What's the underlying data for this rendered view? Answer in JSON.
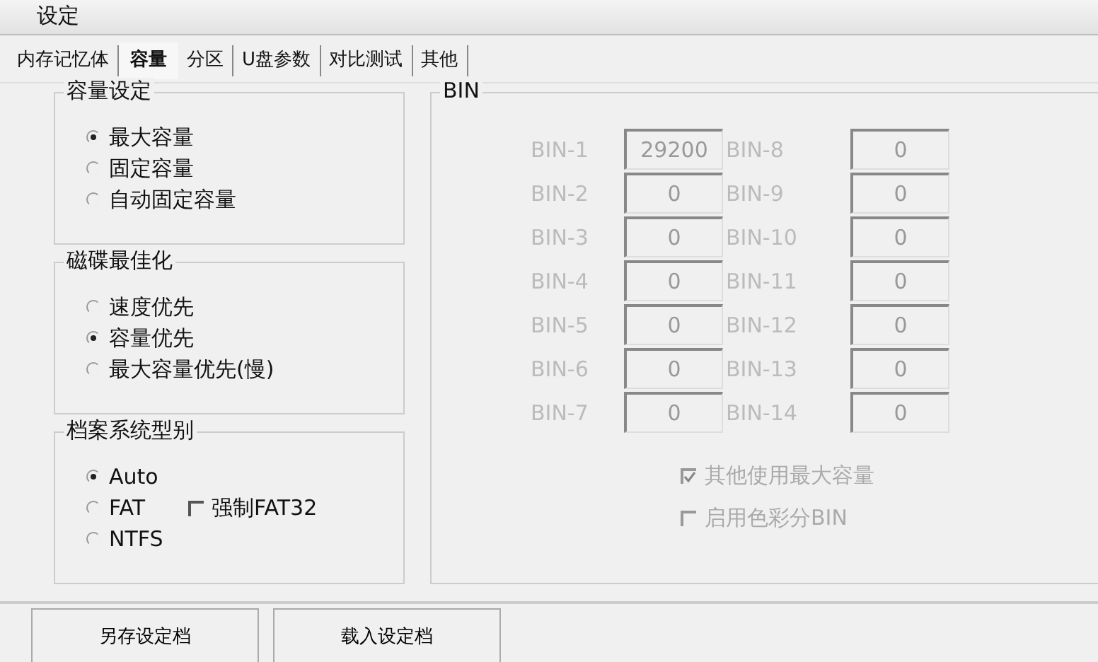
{
  "window": {
    "title": "设定"
  },
  "tabs": [
    {
      "label": "内存记忆体",
      "selected": false
    },
    {
      "label": "容量",
      "selected": true
    },
    {
      "label": "分区",
      "selected": false
    },
    {
      "label": "U盘参数",
      "selected": false
    },
    {
      "label": "对比测试",
      "selected": false
    },
    {
      "label": "其他",
      "selected": false
    }
  ],
  "groups": [
    {
      "title": "容量设定",
      "items": [
        {
          "kind": "radio",
          "label": "最大容量",
          "selected": true
        },
        {
          "kind": "radio",
          "label": "固定容量",
          "selected": false
        },
        {
          "kind": "radio",
          "label": "自动固定容量",
          "selected": false
        }
      ]
    },
    {
      "title": "磁碟最佳化",
      "items": [
        {
          "kind": "radio",
          "label": "速度优先",
          "selected": false
        },
        {
          "kind": "radio",
          "label": "容量优先",
          "selected": true
        },
        {
          "kind": "radio",
          "label": "最大容量优先(慢)",
          "selected": false
        }
      ]
    },
    {
      "title": "档案系统型别",
      "items": [
        {
          "kind": "radio",
          "label": "Auto",
          "selected": true
        },
        {
          "kind": "radio",
          "label": "FAT",
          "selected": false,
          "extra": {
            "label": "强制FAT32",
            "checked": false
          }
        },
        {
          "kind": "radio",
          "label": "NTFS",
          "selected": false
        }
      ]
    }
  ],
  "bin": {
    "title": "BIN",
    "disabled": true,
    "fields": [
      {
        "label": "BIN-1",
        "value": "29200"
      },
      {
        "label": "BIN-2",
        "value": "0"
      },
      {
        "label": "BIN-3",
        "value": "0"
      },
      {
        "label": "BIN-4",
        "value": "0"
      },
      {
        "label": "BIN-5",
        "value": "0"
      },
      {
        "label": "BIN-6",
        "value": "0"
      },
      {
        "label": "BIN-7",
        "value": "0"
      },
      {
        "label": "BIN-8",
        "value": "0"
      },
      {
        "label": "BIN-9",
        "value": "0"
      },
      {
        "label": "BIN-10",
        "value": "0"
      },
      {
        "label": "BIN-11",
        "value": "0"
      },
      {
        "label": "BIN-12",
        "value": "0"
      },
      {
        "label": "BIN-13",
        "value": "0"
      },
      {
        "label": "BIN-14",
        "value": "0"
      }
    ],
    "options": [
      {
        "label": "其他使用最大容量",
        "checked": true,
        "disabled": true
      },
      {
        "label": "启用色彩分BIN",
        "checked": false,
        "disabled": true
      }
    ]
  },
  "buttons": [
    "另存设定档",
    "载入设定档"
  ]
}
